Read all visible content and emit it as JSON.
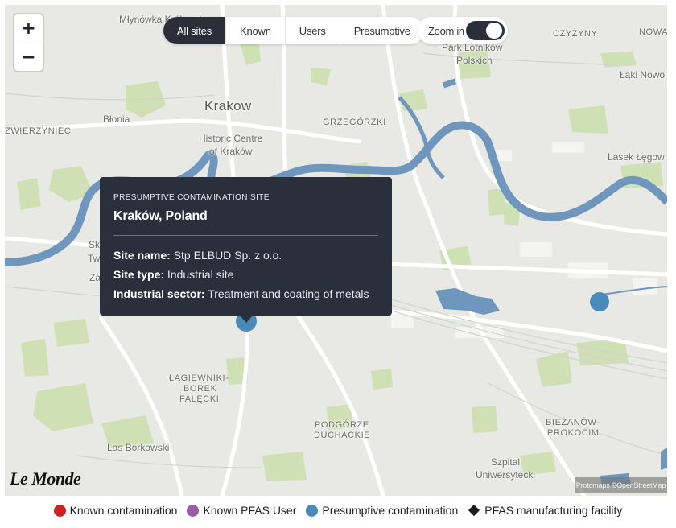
{
  "map": {
    "labels": {
      "mlynowka": "Młynówka Królewska",
      "krakow": "Krakow",
      "blonia": "Błonia",
      "zwierzyniec": "ZWIERZYNIEC",
      "historic": "Historic Centre",
      "historic2": "of Kraków",
      "grzegorzki": "GRZEGÓRZKI",
      "czyzyny": "CZYŻYNY",
      "nowa": "NOWA",
      "park": "Park Lotników",
      "park2": "Polskich",
      "laki": "Łąki Nowo",
      "lasek": "Lasek Łęgow",
      "tw1": "Sk",
      "tw2": "Twardo",
      "za": "Za",
      "lag1": "ŁAGIEWNIKI-",
      "lag2": "BOREK",
      "lag3": "FAŁĘCKI",
      "podgorze1": "PODGÓRZE",
      "podgorze2": "DUCHACKIE",
      "bieza1": "BIEŻANÓW-",
      "bieza2": "PROKOCIM",
      "borkowski": "Las Borkowski",
      "szpital1": "Szpital",
      "szpital2": "Uniwersytecki"
    },
    "attribution": "Protomaps ©OpenStreetMap",
    "pins_color": "#4a8ab8"
  },
  "zoom_controls": {
    "in": "+",
    "out": "−"
  },
  "filters": {
    "all": "All sites",
    "known": "Known",
    "users": "Users",
    "presumptive": "Presumptive",
    "active": "all"
  },
  "zoom_toggle": {
    "label": "Zoom in",
    "on": true
  },
  "tooltip": {
    "kind": "PRESUMPTIVE CONTAMINATION SITE",
    "place": "Kraków, Poland",
    "site_name_label": "Site name:",
    "site_name": "Stp ELBUD Sp. z o.o.",
    "site_type_label": "Site type:",
    "site_type": "Industrial site",
    "sector_label": "Industrial sector:",
    "sector": "Treatment and coating of metals"
  },
  "logo": "Le Monde",
  "legend": [
    {
      "label": "Known contamination",
      "color": "#cc2222",
      "shape": "dot"
    },
    {
      "label": "Known PFAS User",
      "color": "#9b5bab",
      "shape": "dot"
    },
    {
      "label": "Presumptive contamination",
      "color": "#4a8ab8",
      "shape": "dot"
    },
    {
      "label": "PFAS manufacturing facility",
      "color": "#1a1a1a",
      "shape": "diamond"
    }
  ]
}
